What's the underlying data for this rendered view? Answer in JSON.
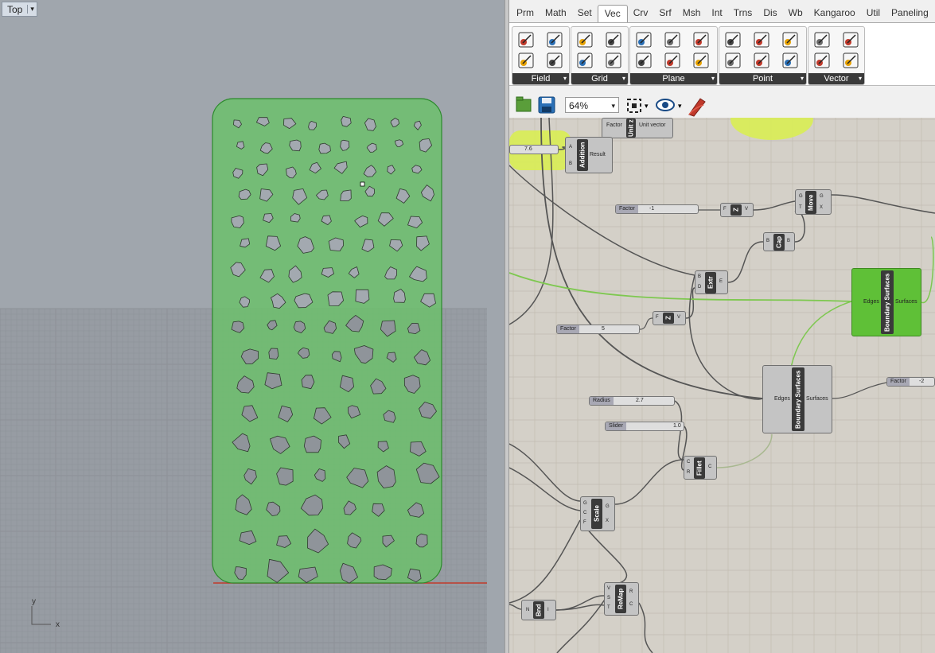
{
  "viewport": {
    "label": "Top",
    "menu_arrow": "▾",
    "axis_y": "y",
    "axis_x": "x",
    "colors": {
      "background": "#a0a6ad",
      "grid": "#8c9197",
      "shape_fill": "#6cc06c",
      "shape_stroke": "#2c8a2c",
      "axis_red": "#c0392b"
    }
  },
  "tabs": [
    "Prm",
    "Math",
    "Set",
    "Vec",
    "Crv",
    "Srf",
    "Msh",
    "Int",
    "Trns",
    "Dis",
    "Wb",
    "Kangaroo",
    "Util",
    "Paneling"
  ],
  "active_tab": "Vec",
  "ribbon": {
    "panels": [
      {
        "caption": "Field",
        "icons": [
          "field-line-icon",
          "field-spin-icon",
          "field-point-icon",
          "field-magnet-icon"
        ]
      },
      {
        "caption": "Grid",
        "icons": [
          "rect-grid-icon",
          "hex-grid-icon",
          "square-grid-icon",
          "radial-grid-icon"
        ]
      },
      {
        "caption": "Plane",
        "icons": [
          "plane-origin-icon",
          "plane-xy-icon",
          "plane-angle-icon",
          "plane-xz-icon",
          "plane-align-icon",
          "plane-rotate-icon"
        ]
      },
      {
        "caption": "Point",
        "icons": [
          "construct-point-icon",
          "distance-icon",
          "closest-point-icon",
          "deconstruct-point-icon",
          "project-point-icon",
          "point-polar-icon"
        ]
      },
      {
        "caption": "Vector",
        "icons": [
          "vector-xyz-icon",
          "vector-2pt-icon",
          "deconstruct-vector-icon",
          "vector-display-icon"
        ]
      }
    ]
  },
  "toolbar": {
    "zoom": "64%",
    "zoom_arrow": "▾"
  },
  "components": {
    "unit": {
      "nick": "Unit z",
      "in": "Factor",
      "out": "Unit vector"
    },
    "addition": {
      "nick": "Addition",
      "in_a": "A",
      "in_b": "B",
      "out": "Result"
    },
    "move": {
      "nick": "Move",
      "in_g": "G",
      "in_t": "T",
      "out_g": "G",
      "out_x": "X"
    },
    "unitz1": {
      "nick": "Z",
      "in": "F",
      "out": "V"
    },
    "cap": {
      "nick": "Cap",
      "in": "B",
      "out": "B"
    },
    "extr": {
      "nick": "Extr",
      "in_b": "B",
      "in_d": "D",
      "out": "E"
    },
    "unitz2": {
      "nick": "Z",
      "in": "F",
      "out": "V"
    },
    "boundary1": {
      "nick": "Boundary Surfaces",
      "in": "Edges",
      "out": "Surfaces"
    },
    "boundary2": {
      "nick": "Boundary Surfaces",
      "in": "Edges",
      "out": "Surfaces"
    },
    "fillet": {
      "nick": "Fillet",
      "in_c": "C",
      "in_r": "R",
      "out": "C"
    },
    "scale": {
      "nick": "Scale",
      "in_g": "G",
      "in_c": "C",
      "in_f": "F",
      "out_g": "G",
      "out_x": "X"
    },
    "remap": {
      "nick": "ReMap",
      "in_v": "V",
      "in_s": "S",
      "in_t": "T",
      "out_r": "R",
      "out_c": "C"
    },
    "bnd": {
      "nick": "Bnd",
      "in": "N",
      "out": "I"
    }
  },
  "sliders": {
    "s_top": {
      "label": "",
      "value": "7.6"
    },
    "factor1": {
      "label": "Factor",
      "value": "-1"
    },
    "factor2": {
      "label": "Factor",
      "value": "5"
    },
    "factor3": {
      "label": "Factor",
      "value": "-2"
    },
    "radius": {
      "label": "Radius",
      "value": "2.7"
    },
    "slider": {
      "label": "Slider",
      "value": "1.0"
    }
  },
  "canvas_colors": {
    "background": "#d4d0c8",
    "grid": "#c2bdb2",
    "wire": "#555555",
    "wire_selected": "#7ec850",
    "selected_component": "#5fc037",
    "group": "#d9ec5a"
  }
}
